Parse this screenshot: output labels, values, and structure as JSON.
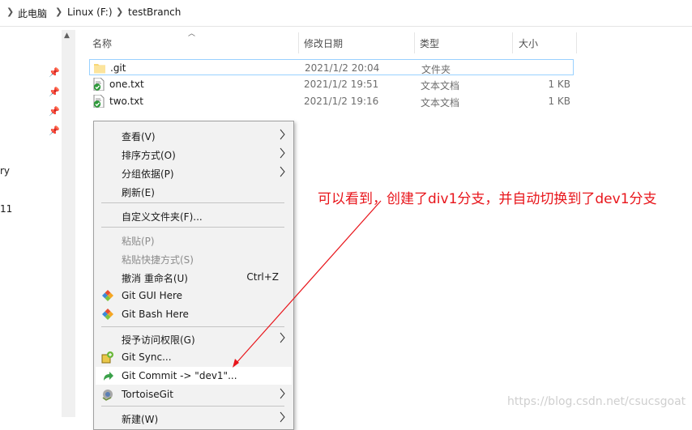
{
  "breadcrumb": {
    "items": [
      "此电脑",
      "Linux (F:)",
      "testBranch"
    ]
  },
  "nav": {
    "partial_labels": [
      "ry",
      "11"
    ],
    "pin_icon": "pin-icon"
  },
  "columns": {
    "name": "名称",
    "date": "修改日期",
    "type": "类型",
    "size": "大小"
  },
  "files": [
    {
      "name": ".git",
      "date": "2021/1/2 20:04",
      "type": "文件夹",
      "size": "",
      "icon": "folder-icon"
    },
    {
      "name": "one.txt",
      "date": "2021/1/2 19:51",
      "type": "文本文档",
      "size": "1 KB",
      "icon": "git-text-file-icon"
    },
    {
      "name": "two.txt",
      "date": "2021/1/2 19:16",
      "type": "文本文档",
      "size": "1 KB",
      "icon": "git-text-file-icon"
    }
  ],
  "context_menu": {
    "items": [
      {
        "label": "查看(V)",
        "submenu": true
      },
      {
        "label": "排序方式(O)",
        "submenu": true
      },
      {
        "label": "分组依据(P)",
        "submenu": true
      },
      {
        "label": "刷新(E)"
      },
      {
        "label": "自定义文件夹(F)..."
      },
      {
        "label": "粘贴(P)",
        "disabled": true
      },
      {
        "label": "粘贴快捷方式(S)",
        "disabled": true
      },
      {
        "label": "撤消 重命名(U)",
        "shortcut": "Ctrl+Z"
      },
      {
        "label": "Git GUI Here",
        "icon": "git-diamond-icon"
      },
      {
        "label": "Git Bash Here",
        "icon": "git-diamond-icon"
      },
      {
        "label": "授予访问权限(G)",
        "submenu": true
      },
      {
        "label": "Git Sync...",
        "icon": "git-sync-icon"
      },
      {
        "label": "Git Commit -> \"dev1\"...",
        "icon": "git-commit-icon"
      },
      {
        "label": "TortoiseGit",
        "icon": "tortoisegit-icon",
        "submenu": true
      },
      {
        "label": "新建(W)",
        "submenu": true
      }
    ]
  },
  "annotation": {
    "text": "可以看到，创建了div1分支，并自动切换到了dev1分支",
    "color": "#e8151b"
  },
  "watermark": "https://blog.csdn.net/csucsgoat"
}
